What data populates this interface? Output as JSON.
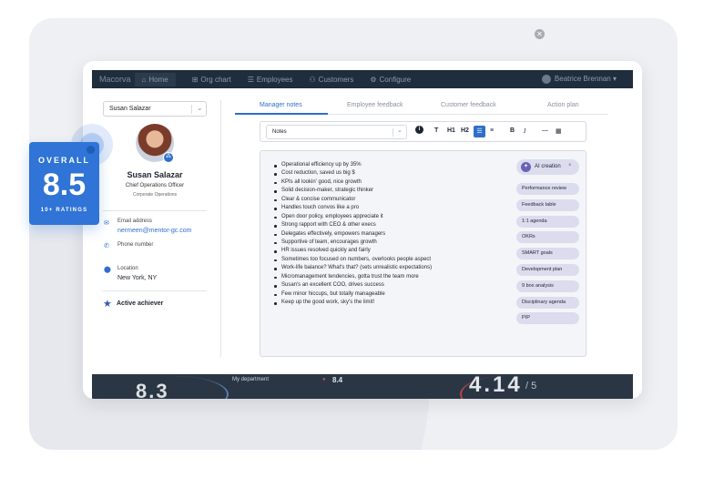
{
  "appbar": {
    "brand": "Macorva",
    "nav": [
      {
        "icon": "home-icon",
        "label": "Home"
      },
      {
        "icon": "org-chart-icon",
        "label": "Org chart"
      },
      {
        "icon": "employees-icon",
        "label": "Employees"
      },
      {
        "icon": "customers-icon",
        "label": "Customers"
      },
      {
        "icon": "configure-icon",
        "label": "Configure"
      }
    ],
    "user": "Beatrice Brennan"
  },
  "background_dashboard": {
    "big_value_left": "8.3",
    "dept_label": "My department",
    "dept_value": "8.4",
    "big_value_right": "4.14",
    "big_value_right_suffix": "/ 5"
  },
  "badge": {
    "overall_label": "OVERALL",
    "score": "8.5",
    "ratings_label": "10+ RATINGS"
  },
  "profile": {
    "selected_person": "Susan Salazar",
    "name": "Susan Salazar",
    "title": "Chief Operations Officer",
    "department": "Corporate Operations",
    "email_label": "Email address",
    "email": "nermeen@mentor-gc.com",
    "phone_label": "Phone number",
    "location_label": "Location",
    "location": "New York, NY",
    "achievement": "Active achiever"
  },
  "tabs": [
    "Manager notes",
    "Employee feedback",
    "Customer feedback",
    "Action plan"
  ],
  "toolbar": {
    "notes_select": "Notes",
    "buttons": {
      "info": "i",
      "text": "T",
      "h1": "H1",
      "h2": "H2",
      "bullets": "☰",
      "numbered": "≡",
      "bold": "B",
      "italic": "I",
      "rule": "—",
      "table": "▦"
    }
  },
  "notes": [
    "Operational efficiency up by 35%",
    "Cost reduction, saved us big $",
    "KPIs all lookin' good, nice growth",
    "Solid decision-maker, strategic thinker",
    "Clear & concise communicator",
    "Handles touch convos like a pro",
    "Open door policy, employees appreciate it",
    "Strong rapport with CEO & other execs",
    "Delegates effectively, empowers managers",
    "Supportive of team, encourages growth",
    "HR issues resolved quickly and fairly",
    "Sometimes too focused on numbers, overlooks people aspect",
    "Work-life balance? What's that? (sets unrealistic expectations)",
    "Micromanagement tendencies, gotta trust the team more",
    "Susan's an excellent COO, drives success",
    "Few minor hiccups, but totally manageable",
    "Keep up the good work, sky's the limit!"
  ],
  "ai": {
    "creation_label": "AI creation",
    "chips": [
      "Performance review",
      "Feedback table",
      "1:1 agenda",
      "OKRs",
      "SMART goals",
      "Development plan",
      "9 box analysis",
      "Disciplinary agenda",
      "PIP"
    ]
  },
  "colors": {
    "accent": "#2f6fc9",
    "badge": "#2f74d6",
    "chip": "#dcdcef",
    "appbar": "#1f2d3d"
  }
}
